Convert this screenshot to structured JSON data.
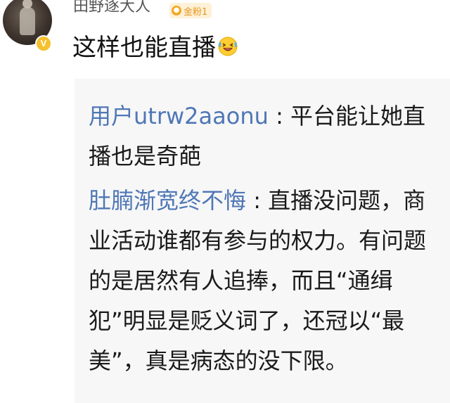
{
  "comment": {
    "username": "田野逐大人",
    "fan_badge": "金粉1",
    "verified_badge": "V",
    "text": "这样也能直播",
    "emoji_icon": "crying-laughing-emoji-icon"
  },
  "replies": [
    {
      "author": "用户utrw2aaonu",
      "separator": " : ",
      "text": "平台能让她直播也是奇葩"
    },
    {
      "author": "肚腩渐宽终不悔",
      "separator": " : ",
      "text": "直播没问题，商业活动谁都有参与的权力。有问题的是居然有人追捧，而且“通缉犯”明显是贬义词了，还冠以“最美”，真是病态的没下限。"
    }
  ],
  "colors": {
    "author_link": "#4f77b6",
    "fan_badge_bg": "#fdf1d8",
    "fan_badge_text": "#e8961a",
    "reply_bg": "#f7f7f7"
  }
}
